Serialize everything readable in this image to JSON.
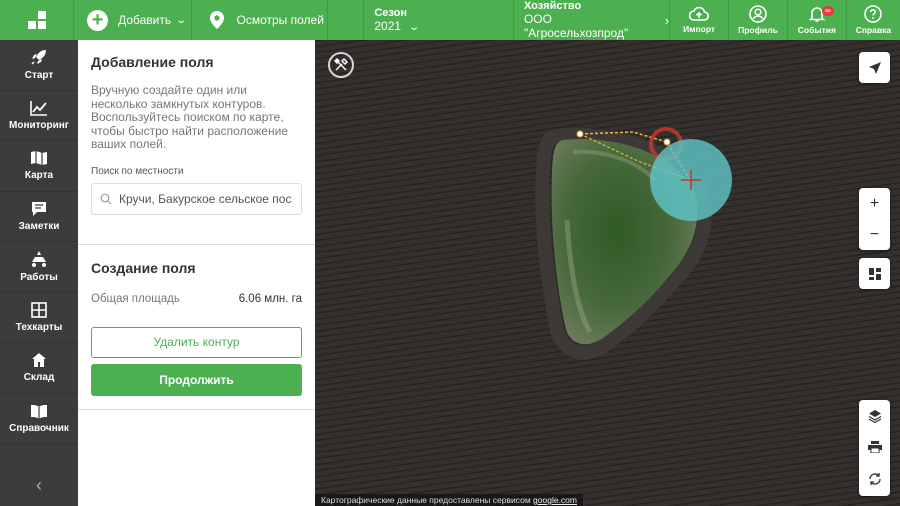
{
  "topbar": {
    "add_label": "Добавить",
    "inspections_label": "Осмотры полей",
    "season_label": "Сезон",
    "season_value": "2021",
    "farm_label": "Хозяйство",
    "farm_value": "ООО \"Агросельхозпрод\"",
    "import_label": "Импорт",
    "profile_label": "Профиль",
    "events_label": "События",
    "events_badge": "∞",
    "help_label": "Справка",
    "accent_color": "#4caf50"
  },
  "sidebar": {
    "items": [
      {
        "label": "Старт",
        "icon": "rocket-icon"
      },
      {
        "label": "Мониторинг",
        "icon": "chart-icon"
      },
      {
        "label": "Карта",
        "icon": "map-icon"
      },
      {
        "label": "Заметки",
        "icon": "note-icon"
      },
      {
        "label": "Работы",
        "icon": "tractor-icon"
      },
      {
        "label": "Техкарты",
        "icon": "grid-icon"
      },
      {
        "label": "Склад",
        "icon": "home-icon"
      },
      {
        "label": "Справочник",
        "icon": "book-icon"
      }
    ],
    "collapse_glyph": "‹"
  },
  "panel": {
    "title": "Добавление поля",
    "description": "Вручную создайте один или несколько замкнутых контуров. Воспользуйтесь поиском по карте, чтобы быстро найти расположение ваших полей.",
    "search_label": "Поиск по местности",
    "search_value": "Кручи, Бакурское сельское пос",
    "create_title": "Создание поля",
    "area_key": "Общая площадь",
    "area_value": "6.06 млн. га",
    "delete_contour_label": "Удалить контур",
    "continue_label": "Продолжить"
  },
  "map": {
    "attribution": "Картографические данные предоставлены сервисом",
    "attribution_link": "google.com",
    "zoom_in": "+",
    "zoom_out": "−"
  }
}
